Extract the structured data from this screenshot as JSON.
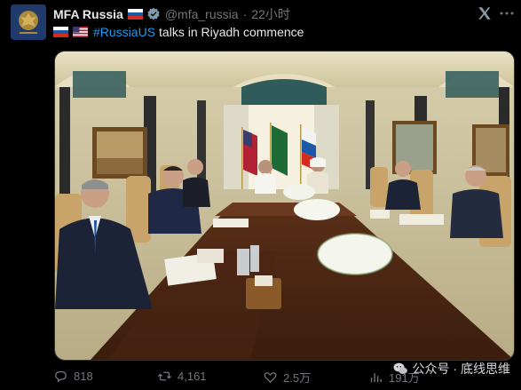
{
  "post": {
    "author_name": "MFA Russia",
    "handle": "@mfa_russia",
    "separator": "·",
    "time_ago": "22小时",
    "flags_header": [
      "russia-flag"
    ],
    "text_flags": [
      "russia-flag",
      "usa-flag"
    ],
    "hashtag": "#RussiaUS",
    "text": "talks in Riyadh commence"
  },
  "actions": {
    "replies": "818",
    "reposts": "4,161",
    "likes": "2.5万",
    "views": "191万"
  },
  "watermark": {
    "text": "公众号 · 底线思维"
  },
  "colors": {
    "background": "#000000",
    "text": "#e7e9ea",
    "secondary": "#71767b",
    "link": "#1d9bf0",
    "verified_badge": "#1d9bf0"
  },
  "icons": [
    "reply-icon",
    "repost-icon",
    "like-icon",
    "views-icon",
    "verified-icon",
    "x-logo-icon",
    "more-icon",
    "wechat-icon"
  ]
}
